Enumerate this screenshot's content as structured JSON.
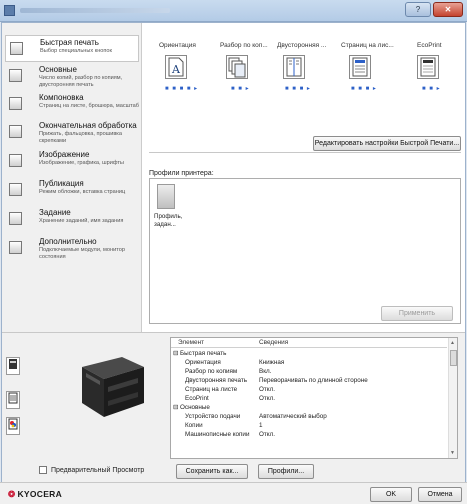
{
  "window": {
    "help_label": "?",
    "close_label": "✕"
  },
  "sidebar": {
    "items": [
      {
        "title": "Быстрая печать",
        "sub": "Выбор специальных кнопок",
        "icon": "quick-print-icon"
      },
      {
        "title": "Основные",
        "sub": "Число копий, разбор по копиям, двусторонняя печать",
        "icon": "basic-icon"
      },
      {
        "title": "Компоновка",
        "sub": "Страниц на листе, брошюра, масштаб",
        "icon": "layout-icon"
      },
      {
        "title": "Окончательная обработка",
        "sub": "Прижать, фальцовка, прошивка скрепками",
        "icon": "finishing-icon"
      },
      {
        "title": "Изображение",
        "sub": "Изображение, графика, шрифты",
        "icon": "image-icon"
      },
      {
        "title": "Публикация",
        "sub": "Режим обложки, вставка страниц",
        "icon": "publishing-icon"
      },
      {
        "title": "Задание",
        "sub": "Хранение заданий, имя задания",
        "icon": "job-icon"
      },
      {
        "title": "Дополнительно",
        "sub": "Подключаемые модули, монитор состояния",
        "icon": "advanced-icon"
      }
    ]
  },
  "quick_print": {
    "columns": [
      "Ориентация",
      "Разбор по коп...",
      "Двусторонняя ...",
      "Страниц на лис...",
      "EcoPrint"
    ],
    "dots": [
      "■ ■ ■ ■ ▸",
      "■ ■ ▸",
      "■ ■ ■ ▸",
      "■ ■ ■ ▸",
      "■ ■ ▸"
    ],
    "edit_button": "Редактировать настройки Быстрой Печати...",
    "profiles_label": "Профили принтера:",
    "profile_tile": "Профиль, задан...",
    "apply_button": "Применить"
  },
  "bottom": {
    "preview_checkbox": "Предварительный Просмотр",
    "save_as_button": "Сохранить как...",
    "profiles_button": "Профили...",
    "table": {
      "headers": [
        "Элемент",
        "Сведения"
      ],
      "rows": [
        {
          "key": "⊟ Быстрая печать",
          "value": "",
          "group": true
        },
        {
          "key": "Ориентация",
          "value": "Книжная"
        },
        {
          "key": "Разбор по копиям",
          "value": "Вкл."
        },
        {
          "key": "Двусторонняя печать",
          "value": "Переворачивать по длинной стороне"
        },
        {
          "key": "Страниц на листе",
          "value": "Откл."
        },
        {
          "key": "EcoPrint",
          "value": "Откл."
        },
        {
          "key": "⊟ Основные",
          "value": "",
          "group": true
        },
        {
          "key": "Устройство подачи",
          "value": "Автоматический выбор"
        },
        {
          "key": "Копии",
          "value": "1"
        },
        {
          "key": "Машинописные копии",
          "value": "Откл."
        }
      ]
    }
  },
  "footer": {
    "logo_mark": "❂",
    "logo_text": "KYOCERA",
    "ok_button": "OK",
    "cancel_button": "Отмена"
  },
  "colors": {
    "accent": "#2e61c8",
    "brand": "#c8102e",
    "title_bar": "#c9dbef"
  }
}
